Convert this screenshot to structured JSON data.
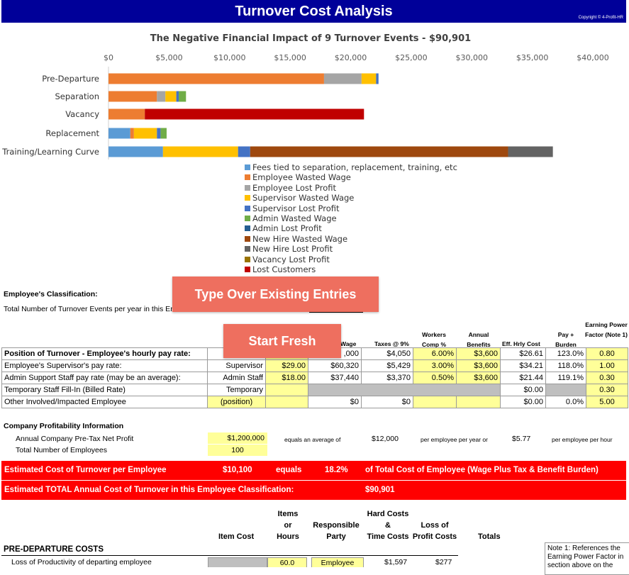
{
  "header": {
    "title": "Turnover Cost Analysis",
    "copyright": "Copyright © 4-Profit-HR"
  },
  "colors": {
    "header_bg": "#000099",
    "banner_red": "#ff0000",
    "button_bg": "#ee6f5f",
    "input_yellow": "#ffff99",
    "disabled_gray": "#bfbfbf"
  },
  "chart_data": {
    "type": "bar",
    "orientation": "horizontal",
    "stacked": true,
    "title": "The Negative Financial Impact of 9 Turnover Events - $90,901",
    "x_tick_labels": [
      "$0",
      "$5,000",
      "$10,000",
      "$15,000",
      "$20,000",
      "$25,000",
      "$30,000",
      "$35,000",
      "$40,000"
    ],
    "xlim": [
      0,
      40000
    ],
    "x_axis_position": "top",
    "legend_position": "bottom",
    "categories": [
      "Pre-Departure",
      "Separation",
      "Vacancy",
      "Replacement",
      "Training/Learning Curve"
    ],
    "series": [
      {
        "name": "Fees tied to separation, replacement, training, etc",
        "color": "#5b9bd5",
        "values": [
          0,
          0,
          0,
          1800,
          4500
        ]
      },
      {
        "name": "Employee Wasted Wage",
        "color": "#ed7d31",
        "values": [
          17800,
          4000,
          3000,
          300,
          0
        ]
      },
      {
        "name": "Employee Lost Profit",
        "color": "#a5a5a5",
        "values": [
          3100,
          700,
          0,
          0,
          0
        ]
      },
      {
        "name": "Supervisor Wasted Wage",
        "color": "#ffc000",
        "values": [
          1200,
          900,
          0,
          1900,
          6200
        ]
      },
      {
        "name": "Supervisor Lost Profit",
        "color": "#4472c4",
        "values": [
          200,
          200,
          0,
          300,
          1000
        ]
      },
      {
        "name": "Admin Wasted Wage",
        "color": "#70ad47",
        "values": [
          0,
          600,
          0,
          500,
          0
        ]
      },
      {
        "name": "Admin Lost Profit",
        "color": "#255e91",
        "values": [
          0,
          0,
          0,
          0,
          0
        ]
      },
      {
        "name": "New Hire Wasted Wage",
        "color": "#9e480e",
        "values": [
          0,
          0,
          0,
          0,
          21300
        ]
      },
      {
        "name": "New Hire Lost Profit",
        "color": "#636363",
        "values": [
          0,
          0,
          0,
          0,
          3700
        ]
      },
      {
        "name": "Vacancy Lost Profit",
        "color": "#997300",
        "values": [
          0,
          0,
          0,
          0,
          0
        ]
      },
      {
        "name": "Lost Customers",
        "color": "#c00000",
        "values": [
          0,
          0,
          18100,
          0,
          0
        ]
      }
    ]
  },
  "classification": {
    "label": "Employee's Classification:",
    "events_label": "Total Number of Turnover Events per year in this En"
  },
  "buttons": {
    "type_over": "Type Over Existing Entries",
    "start_fresh": "Start Fresh"
  },
  "rates_table": {
    "col_headers": {
      "wage": "Wage",
      "taxes": "Taxes @ 9%",
      "workers_comp": "Workers Comp %",
      "annual_benefits": "Annual Benefits",
      "eff_hrly_cost": "Eff. Hrly Cost",
      "pay_burden": "Pay + Burden",
      "earning_power": "Earning Power Factor (Note 1)"
    },
    "rows": [
      {
        "label": "Position of Turnover - Employee's hourly pay rate:",
        "role": "E",
        "rate": "",
        "wage": ",000",
        "taxes": "$4,050",
        "wc": "6.00%",
        "benefits": "$3,600",
        "eff": "$26.61",
        "burden": "123.0%",
        "epf": "0.80"
      },
      {
        "label": "Employee's Supervisor's pay rate:",
        "role": "Supervisor",
        "rate": "$29.00",
        "wage": "$60,320",
        "taxes": "$5,429",
        "wc": "3.00%",
        "benefits": "$3,600",
        "eff": "$34.21",
        "burden": "118.0%",
        "epf": "1.00"
      },
      {
        "label": "Admin Support Staff pay rate (may be an average):",
        "role": "Admin Staff",
        "rate": "$18.00",
        "wage": "$37,440",
        "taxes": "$3,370",
        "wc": "0.50%",
        "benefits": "$3,600",
        "eff": "$21.44",
        "burden": "119.1%",
        "epf": "0.30"
      },
      {
        "label": "Temporary Staff Fill-In (Billed Rate)",
        "role": "Temporary",
        "rate": "",
        "wage": "",
        "taxes": "",
        "wc": "",
        "benefits": "",
        "eff": "$0.00",
        "burden": "",
        "epf": "0.30"
      },
      {
        "label": "Other Involved/Impacted Employee",
        "role": "(position)",
        "rate": "",
        "wage": "$0",
        "taxes": "$0",
        "wc": "",
        "benefits": "",
        "eff": "$0.00",
        "burden": "0.0%",
        "epf": "5.00"
      }
    ]
  },
  "profitability": {
    "title": "Company Profitability Information",
    "net_profit_label": "Annual Company Pre-Tax Net Profit",
    "net_profit_value": "$1,200,000",
    "employees_label": "Total Number of Employees",
    "employees_value": "100",
    "equals_avg": "equals an average of",
    "per_employee_year": "$12,000",
    "per_employee_year_label": "per employee per year or",
    "per_employee_hour": "$5.77",
    "per_employee_hour_label": "per employee per hour"
  },
  "summary": {
    "cost_per_employee_label": "Estimated Cost of Turnover per Employee",
    "cost_per_employee_value": "$10,100",
    "equals": "equals",
    "percent": "18.2%",
    "percent_label": "of Total Cost of Employee (Wage Plus Tax & Benefit Burden)",
    "total_label": "Estimated TOTAL Annual Cost of Turnover in this Employee Classification:",
    "total_value": "$90,901"
  },
  "bottom": {
    "headers": {
      "item_cost": "Item Cost",
      "items_hours": [
        "Items",
        "or",
        "Hours"
      ],
      "responsible": [
        "Responsible",
        "Party"
      ],
      "hard_costs": [
        "Hard Costs",
        "&",
        "Time Costs"
      ],
      "loss_of": [
        "Loss of",
        "Profit Costs"
      ],
      "totals": "Totals"
    },
    "section_title": "PRE-DEPARTURE COSTS",
    "row": {
      "label": "Loss of Productivity of departing employee",
      "hours": "60.0",
      "party": "Employee",
      "hard": "$1,597",
      "loss": "$277"
    },
    "note": "Note 1: References the Earning Power Factor in section above on the"
  }
}
